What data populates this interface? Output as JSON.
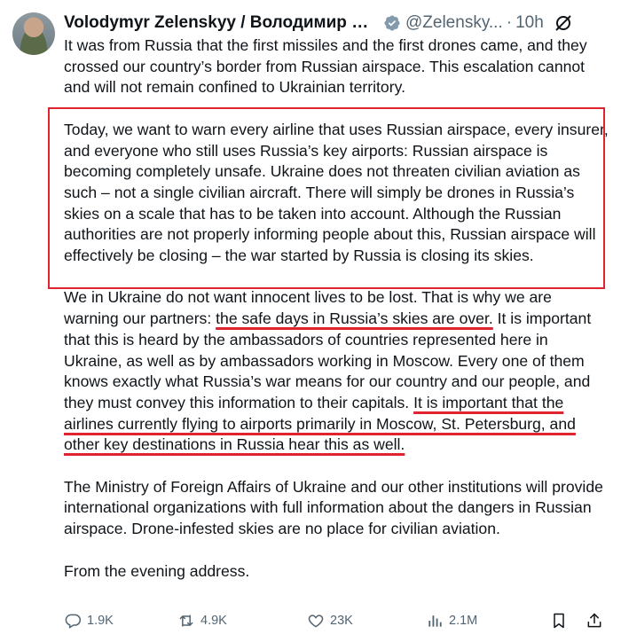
{
  "author": {
    "name": "Volodymyr Zelenskyy / Володимир Зеле...",
    "handle": "@Zelensky...",
    "separator": "·",
    "time": "10h",
    "avatar_icon": "profile-photo",
    "verified_icon": "verified-badge",
    "verified_color": "#829aab"
  },
  "post": {
    "p1": "It was from Russia that the first missiles and the first drones came, and they crossed our country’s border from Russian airspace. This escalation cannot and will not remain confined to Ukrainian territory.",
    "p2": "Today, we want to warn every airline that uses Russian airspace, every insurer, and everyone who still uses Russia’s key airports: Russian airspace is becoming completely unsafe. Ukraine does not threaten civilian aviation as such – not a single civilian aircraft. There will simply be drones in Russia’s skies on a scale that has to be taken into account. Although the Russian authorities are not properly informing people about this, Russian airspace will effectively be closing – the war started by Russia is closing its skies.",
    "p3_a": "We in Ukraine do not want innocent lives to be lost. That is why we are warning our partners: ",
    "p3_u1": "the safe days in Russia’s skies are over.",
    "p3_b": " It is important that this is heard by the ambassadors of countries represented here in Ukraine, as well as by ambassadors working in Moscow. Every one of them knows exactly what Russia’s war means for our country and our people, and they must convey this information to their capitals. ",
    "p3_u2": "It is important that the airlines currently flying to airports primarily in Moscow, St. Petersburg, and other key destinations in Russia hear this as well.",
    "p4": "The Ministry of Foreign Affairs of Ukraine and our other institutions will provide international organizations with full information about the dangers in Russian airspace. Drone-infested skies are no place for civilian aviation.",
    "p5": "From the evening address.",
    "highlight_color": "#e0242f"
  },
  "actions": {
    "replies": "1.9K",
    "reposts": "4.9K",
    "likes": "23K",
    "views": "2.1M"
  }
}
